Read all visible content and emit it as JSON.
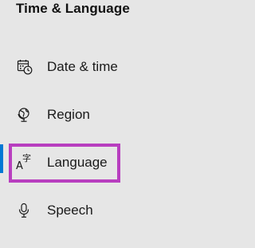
{
  "header": {
    "title": "Time & Language"
  },
  "sidebar": {
    "items": [
      {
        "label": "Date & time",
        "icon": "calendar-clock-icon",
        "selected": false
      },
      {
        "label": "Region",
        "icon": "globe-icon",
        "selected": false
      },
      {
        "label": "Language",
        "icon": "language-icon",
        "selected": true,
        "icon_glyphs": [
          "A",
          "字"
        ]
      },
      {
        "label": "Speech",
        "icon": "microphone-icon",
        "selected": false
      }
    ]
  },
  "colors": {
    "background": "#e6e6e6",
    "text": "#111111",
    "accent": "#0078d4",
    "annotation_highlight": "#b83ebf"
  }
}
